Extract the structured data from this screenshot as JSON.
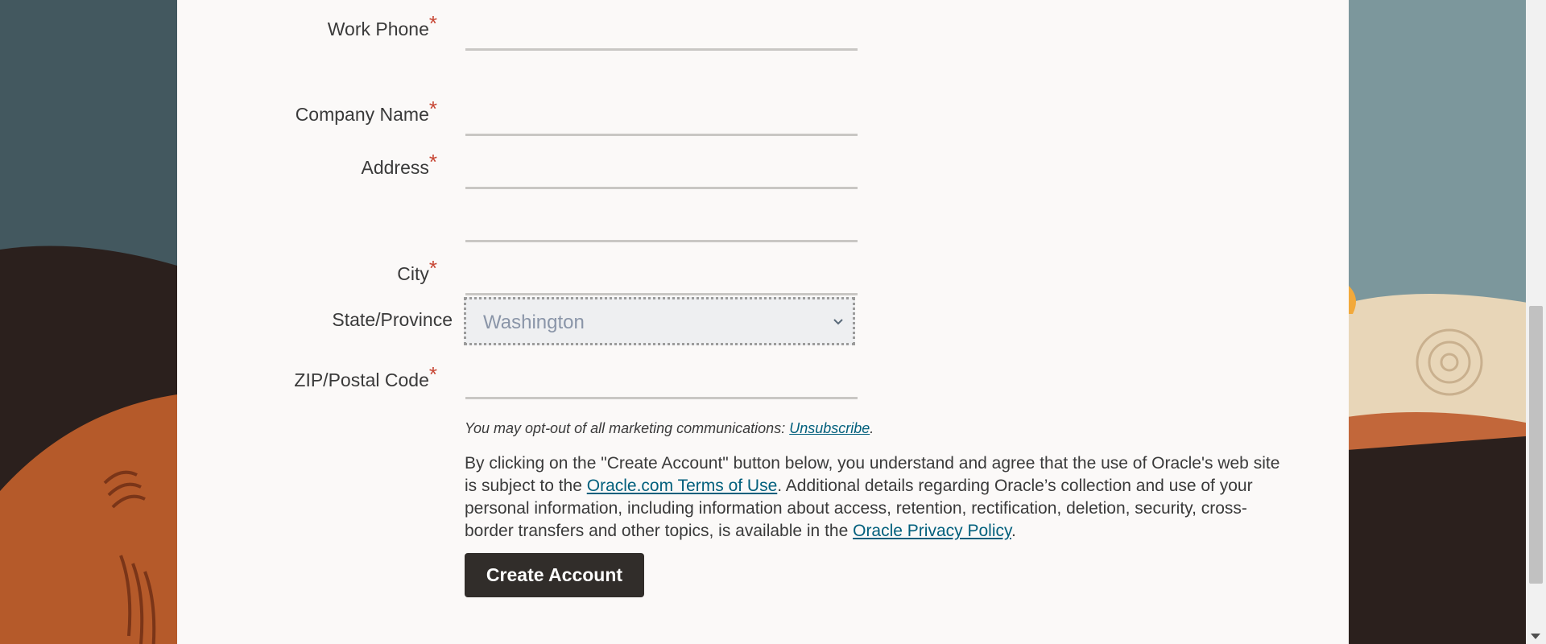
{
  "form": {
    "fields": [
      {
        "label": "Work Phone",
        "required": true
      },
      {
        "label": "Company Name",
        "required": true
      },
      {
        "label": "Address",
        "required": true
      },
      {
        "label": "City",
        "required": true
      },
      {
        "label": "State/Province",
        "required": false
      },
      {
        "label": "ZIP/Postal Code",
        "required": true
      }
    ],
    "required_marker": "*",
    "state_value": "Washington"
  },
  "optout": {
    "text": "You may opt-out of all marketing communications: ",
    "link": "Unsubscribe",
    "end": "."
  },
  "legal": {
    "part1": "By clicking on the \"Create Account\" button below, you understand and agree that the use of Oracle's web site is subject to the ",
    "terms_link": "Oracle.com Terms of Use",
    "part2": ". Additional details regarding Oracle’s collection and use of your personal information, including information about access, retention, rectification, deletion, security, cross-border transfers and other topics, is available in the ",
    "privacy_link": "Oracle Privacy Policy",
    "part3": "."
  },
  "button": {
    "label": "Create Account"
  },
  "colors": {
    "accent": "#c74634",
    "link": "#015f7c",
    "button": "#312d2a",
    "panel": "#fbf9f8"
  }
}
